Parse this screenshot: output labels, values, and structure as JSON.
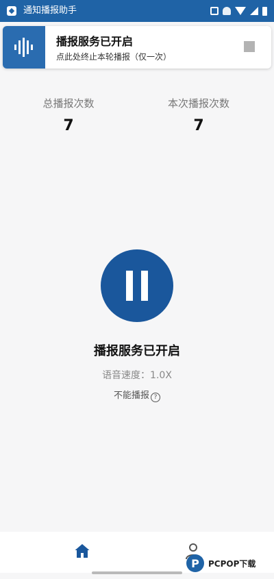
{
  "statusbar": {
    "app_name": "通知播报助手"
  },
  "notification": {
    "title": "播报服务已开启",
    "subtitle": "点此处终止本轮播报（仅一次）"
  },
  "stats": {
    "total_label": "总播报次数",
    "total_value": "7",
    "current_label": "本次播报次数",
    "current_value": "7"
  },
  "control": {
    "status_text": "播报服务已开启",
    "speed_text": "语音速度：1.0X",
    "cannot_play_text": "不能播报"
  },
  "watermark": {
    "text": "PCPOP下载",
    "logo_letter": "P"
  },
  "icons": {
    "notification": "voice-wave-icon",
    "stop": "stop-icon",
    "pause": "pause-icon",
    "help": "question-icon",
    "home": "home-icon",
    "user": "user-icon"
  },
  "colors": {
    "accent": "#1a579c",
    "statusbar": "#1f63a6"
  }
}
